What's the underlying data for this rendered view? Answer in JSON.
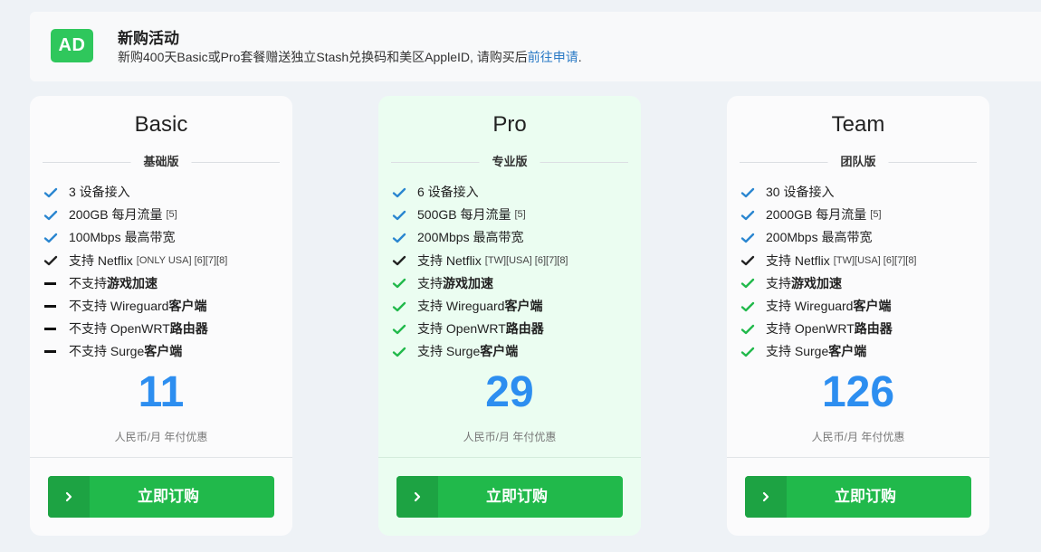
{
  "ad": {
    "badge": "AD",
    "title": "新购活动",
    "desc_prefix": "新购400天Basic或Pro套餐赠送独立Stash兑换码和美区AppleID, 请购买后",
    "desc_link": "前往申请",
    "desc_suffix": "."
  },
  "colors": {
    "accent": "#2d8ef0",
    "green": "#21b94b",
    "check_blue": "#2a86d0",
    "check_green": "#21b94b"
  },
  "plans": [
    {
      "name": "Basic",
      "subtitle": "基础版",
      "features": [
        {
          "icon": "check-blue",
          "pre": "3 设备接入",
          "b": "",
          "post": "",
          "small": ""
        },
        {
          "icon": "check-blue",
          "pre": "200GB 每月流量",
          "b": "",
          "post": "",
          "small": "[5]"
        },
        {
          "icon": "check-blue",
          "pre": "100Mbps 最高带宽",
          "b": "",
          "post": "",
          "small": ""
        },
        {
          "icon": "check-dark",
          "pre": "支持 Netflix",
          "b": "",
          "post": "",
          "small": "[ONLY USA] [6][7][8]"
        },
        {
          "icon": "dash",
          "pre": "不支持 ",
          "b": "游戏加速",
          "post": "",
          "small": ""
        },
        {
          "icon": "dash",
          "pre": "不支持 Wireguard ",
          "b": "客户端",
          "post": "",
          "small": ""
        },
        {
          "icon": "dash",
          "pre": "不支持 OpenWRT ",
          "b": "路由器",
          "post": "",
          "small": ""
        },
        {
          "icon": "dash",
          "pre": "不支持 Surge ",
          "b": "客户端",
          "post": "",
          "small": ""
        }
      ],
      "price": "11",
      "price_note": "人民币/月 年付优惠",
      "button": "立即订购"
    },
    {
      "name": "Pro",
      "subtitle": "专业版",
      "features": [
        {
          "icon": "check-blue",
          "pre": "6 设备接入",
          "b": "",
          "post": "",
          "small": ""
        },
        {
          "icon": "check-blue",
          "pre": "500GB 每月流量",
          "b": "",
          "post": "",
          "small": "[5]"
        },
        {
          "icon": "check-blue",
          "pre": "200Mbps 最高带宽",
          "b": "",
          "post": "",
          "small": ""
        },
        {
          "icon": "check-dark",
          "pre": "支持 Netflix",
          "b": "",
          "post": "",
          "small": "[TW][USA] [6][7][8]"
        },
        {
          "icon": "check-green",
          "pre": "支持 ",
          "b": "游戏加速",
          "post": "",
          "small": ""
        },
        {
          "icon": "check-green",
          "pre": "支持 Wireguard ",
          "b": "客户端",
          "post": "",
          "small": ""
        },
        {
          "icon": "check-green",
          "pre": "支持 OpenWRT ",
          "b": "路由器",
          "post": "",
          "small": ""
        },
        {
          "icon": "check-green",
          "pre": "支持 Surge ",
          "b": "客户端",
          "post": "",
          "small": ""
        }
      ],
      "price": "29",
      "price_note": "人民币/月 年付优惠",
      "button": "立即订购"
    },
    {
      "name": "Team",
      "subtitle": "团队版",
      "features": [
        {
          "icon": "check-blue",
          "pre": "30 设备接入",
          "b": "",
          "post": "",
          "small": ""
        },
        {
          "icon": "check-blue",
          "pre": "2000GB 每月流量",
          "b": "",
          "post": "",
          "small": "[5]"
        },
        {
          "icon": "check-blue",
          "pre": "200Mbps 最高带宽",
          "b": "",
          "post": "",
          "small": ""
        },
        {
          "icon": "check-dark",
          "pre": "支持 Netflix",
          "b": "",
          "post": "",
          "small": "[TW][USA] [6][7][8]"
        },
        {
          "icon": "check-green",
          "pre": "支持 ",
          "b": "游戏加速",
          "post": "",
          "small": ""
        },
        {
          "icon": "check-green",
          "pre": "支持 Wireguard ",
          "b": "客户端",
          "post": "",
          "small": ""
        },
        {
          "icon": "check-green",
          "pre": "支持 OpenWRT ",
          "b": "路由器",
          "post": "",
          "small": ""
        },
        {
          "icon": "check-green",
          "pre": "支持 Surge ",
          "b": "客户端",
          "post": "",
          "small": ""
        }
      ],
      "price": "126",
      "price_note": "人民币/月 年付优惠",
      "button": "立即订购"
    }
  ]
}
